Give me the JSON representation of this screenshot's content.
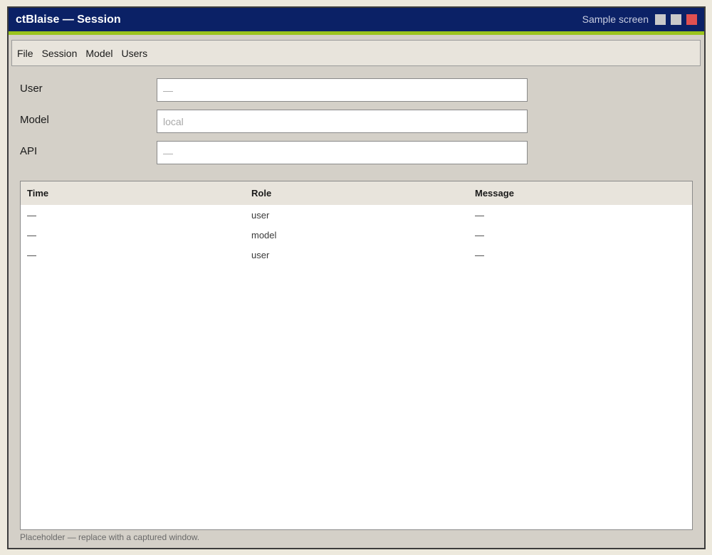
{
  "window": {
    "title": "ctBlaise — Session",
    "badge": "Sample screen",
    "accent_color": "#9ac41c",
    "titlebar_color": "#0b2166"
  },
  "menu": {
    "items": [
      "File",
      "Session",
      "Model",
      "Users"
    ]
  },
  "form": {
    "user": {
      "label": "User",
      "placeholder": "—"
    },
    "model": {
      "label": "Model",
      "placeholder": "local"
    },
    "api": {
      "label": "API",
      "placeholder": "—"
    }
  },
  "table": {
    "columns": [
      "Time",
      "Role",
      "Message"
    ],
    "rows": [
      [
        "—",
        "user",
        "—"
      ],
      [
        "—",
        "model",
        "—"
      ],
      [
        "—",
        "user",
        "—"
      ]
    ]
  },
  "footnote": "Placeholder — replace with a captured window."
}
